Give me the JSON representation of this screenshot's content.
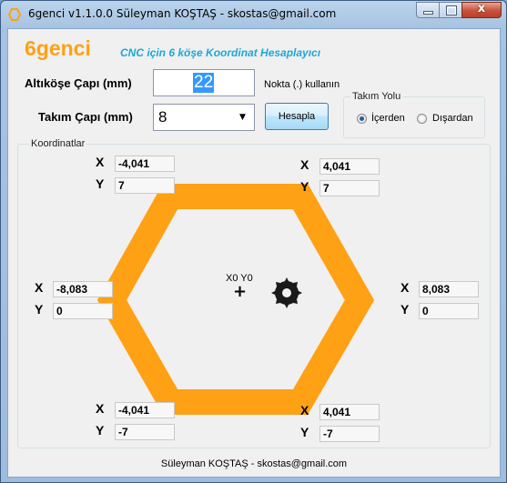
{
  "window": {
    "title": "6genci v1.1.0.0  Süleyman KOŞTAŞ - skostas@gmail.com",
    "close_glyph": "x"
  },
  "header": {
    "brand": "6genci",
    "subtitle": "CNC için 6 köşe  Koordinat Hesaplayıcı"
  },
  "form": {
    "hex_diameter_label": "Altıköşe Çapı (mm)",
    "hex_diameter_value": "22",
    "tool_diameter_label": "Takım Çapı (mm)",
    "tool_diameter_value": "8",
    "hint": "Nokta (.) kullanın",
    "calc_button": "Hesapla"
  },
  "tool_path": {
    "title": "Takım Yolu",
    "options": [
      {
        "label": "İçerden",
        "selected": true
      },
      {
        "label": "Dışardan",
        "selected": false
      }
    ]
  },
  "coords": {
    "title": "Koordinatlar",
    "x_label": "X",
    "y_label": "Y",
    "top_left": {
      "x": "-4,041",
      "y": "7"
    },
    "top_right": {
      "x": "4,041",
      "y": "7"
    },
    "left": {
      "x": "-8,083",
      "y": "0"
    },
    "right": {
      "x": "8,083",
      "y": "0"
    },
    "bottom_left": {
      "x": "-4,041",
      "y": "-7"
    },
    "bottom_right": {
      "x": "4,041",
      "y": "-7"
    },
    "origin_label": "X0 Y0",
    "origin_marker": "+"
  },
  "colors": {
    "hexagon": "#ffa114",
    "brand": "#ffa114",
    "subtitle": "#1ea7d6"
  },
  "footer": "Süleyman KOŞTAŞ - skostas@gmail.com"
}
